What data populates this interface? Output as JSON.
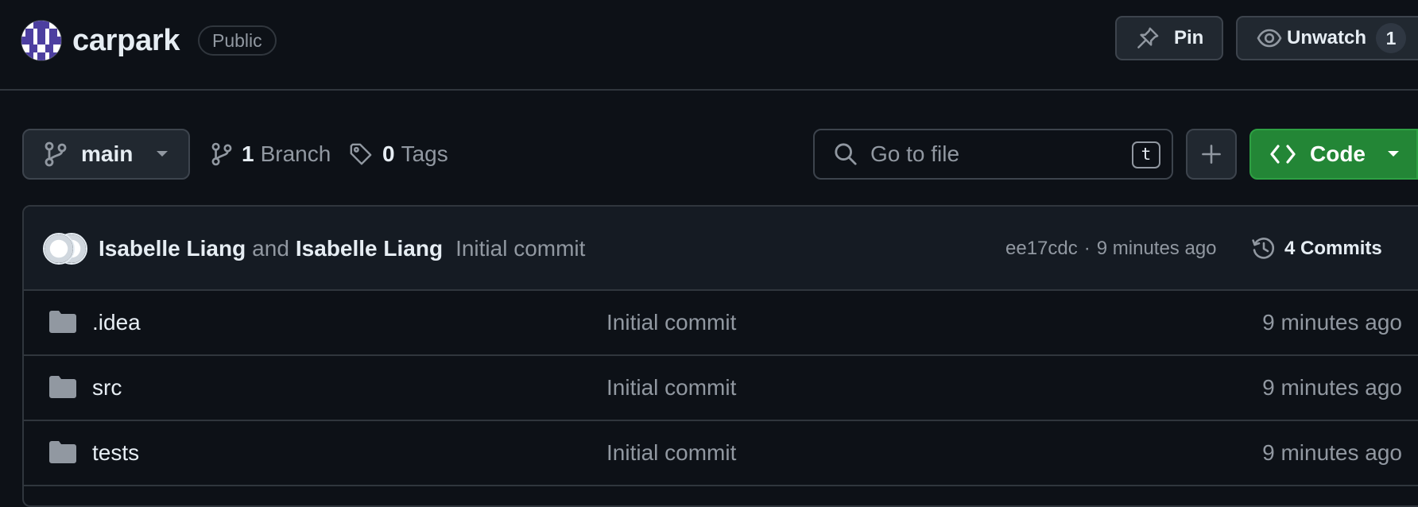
{
  "repo": {
    "name": "carpark",
    "visibility": "Public"
  },
  "header_actions": {
    "pin_label": "Pin",
    "watch_label": "Unwatch",
    "watch_count": "1"
  },
  "toolbar": {
    "branch_name": "main",
    "branch_count": "1",
    "branch_label": "Branch",
    "tag_count": "0",
    "tag_label": "Tags",
    "search_placeholder": "Go to file",
    "search_shortcut": "t",
    "code_label": "Code"
  },
  "latest_commit": {
    "author_1": "Isabelle Liang",
    "conjunction": "and",
    "author_2": "Isabelle Liang",
    "message": "Initial commit",
    "sha": "ee17cdc",
    "separator": "·",
    "time": "9 minutes ago",
    "commits_count_label": "4 Commits"
  },
  "files": [
    {
      "name": ".idea",
      "message": "Initial commit",
      "time": "9 minutes ago",
      "icon": "folder-icon"
    },
    {
      "name": "src",
      "message": "Initial commit",
      "time": "9 minutes ago",
      "icon": "folder-icon"
    },
    {
      "name": "tests",
      "message": "Initial commit",
      "time": "9 minutes ago",
      "icon": "folder-icon"
    }
  ],
  "colors": {
    "background": "#0d1117",
    "border": "#30363d",
    "code_button": "#238636",
    "muted_text": "#9198a1",
    "primary_text": "#e6edf3",
    "folder_icon": "#9198a1",
    "avatar_accent": "#4d3fa0"
  }
}
